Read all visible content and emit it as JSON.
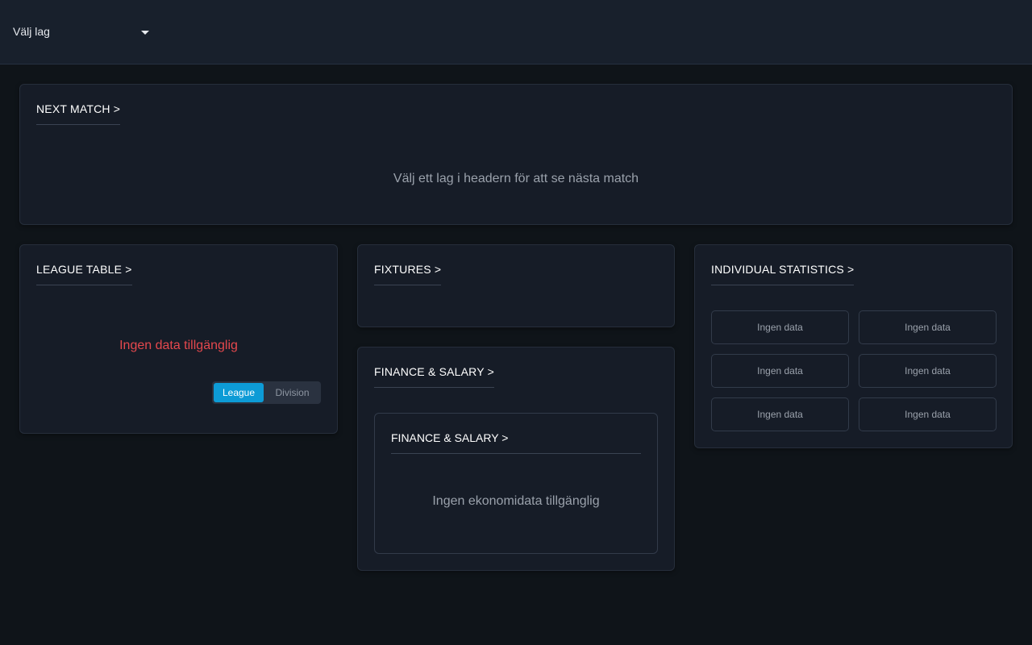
{
  "header": {
    "team_select": {
      "label": "Välj lag",
      "icon": "caret-down-icon"
    }
  },
  "next_match": {
    "title": "NEXT MATCH >",
    "message": "Välj ett lag i headern för att se nästa match"
  },
  "league_table": {
    "title": "LEAGUE TABLE >",
    "message": "Ingen data tillgänglig",
    "toggle": {
      "options": [
        "League",
        "Division"
      ],
      "selected": "League"
    }
  },
  "fixtures": {
    "title": "FIXTURES >"
  },
  "finance": {
    "title": "FINANCE & SALARY >",
    "inner": {
      "title": "FINANCE & SALARY >",
      "message": "Ingen ekonomidata tillgänglig"
    }
  },
  "individual_statistics": {
    "title": "INDIVIDUAL STATISTICS >",
    "items": [
      "Ingen data",
      "Ingen data",
      "Ingen data",
      "Ingen data",
      "Ingen data",
      "Ingen data"
    ]
  },
  "colors": {
    "background": "#0f1419",
    "card": "#161c27",
    "accent": "#0d9bd6",
    "error": "#e5484d"
  }
}
